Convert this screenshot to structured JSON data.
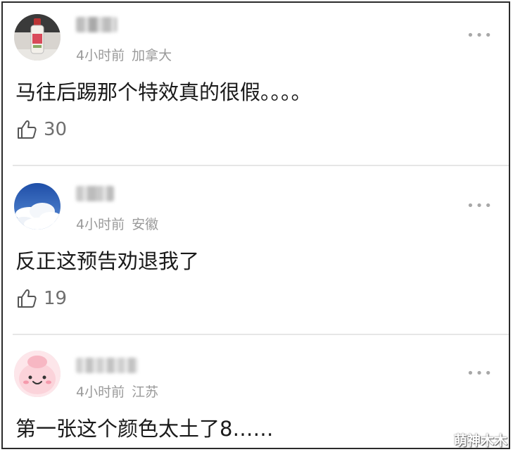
{
  "comments": [
    {
      "time": "4小时前",
      "location": "加拿大",
      "text": "马往后踢那个特效真的很假。。。。",
      "likes": "30",
      "avatar_icon": "bottle-photo-avatar"
    },
    {
      "time": "4小时前",
      "location": "安徽",
      "text": "反正这预告劝退我了",
      "likes": "19",
      "avatar_icon": "sky-clouds-avatar"
    },
    {
      "time": "4小时前",
      "location": "江苏",
      "text": "第一张这个颜色太土了8……",
      "avatar_icon": "pink-cartoon-avatar"
    }
  ],
  "more_glyph": "•••",
  "watermark": "萌神木木",
  "colors": {
    "meta": "#9a9a9a",
    "text": "#1a1a1a",
    "divider": "#e6e6e6",
    "frame": "#2b2b2b"
  }
}
